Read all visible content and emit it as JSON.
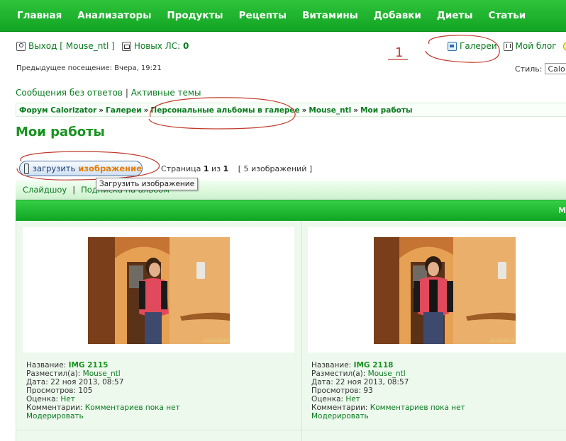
{
  "nav": {
    "items": [
      "Главная",
      "Анализаторы",
      "Продукты",
      "Рецепты",
      "Витамины",
      "Добавки",
      "Диеты",
      "Статьи"
    ]
  },
  "user": {
    "logout_label": "Выход [ Mouse_ntl ]",
    "new_pm_label": "Новых ЛС:",
    "new_pm_count": "0",
    "previous_visit": "Предыдущее посещение: Вчера, 19:21"
  },
  "links": {
    "gallery": "Галереи",
    "blog": "Мой блог"
  },
  "style": {
    "label": "Стиль:",
    "value": "Calo"
  },
  "quick": {
    "unanswered": "Сообщения без ответов",
    "separator": "|",
    "active": "Активные темы"
  },
  "breadcrumb": [
    "Форум Calorizator",
    "Галереи",
    "Персональные альбомы в галерее",
    "Mouse_ntl",
    "Мои работы"
  ],
  "page": {
    "title": "Мои работы"
  },
  "upload": {
    "word1": "загрузить",
    "word2": "изображение",
    "tooltip": "Загрузить изображение"
  },
  "pagination": {
    "prefix": "Страница",
    "current": "1",
    "of": "из",
    "total": "1",
    "count": "[ 5 изображений ]"
  },
  "subbar": {
    "slideshow": "Слайдшоу",
    "separator": "|",
    "subscribe": "Подписка на альбом"
  },
  "greenbar": {
    "label": "M"
  },
  "annotation": {
    "mark": "1"
  },
  "images": [
    {
      "name_label": "Название:",
      "name": "IMG 2115",
      "uploader_label": "Разместил(а):",
      "uploader": "Mouse_ntl",
      "date_label": "Дата:",
      "date": "22 ноя 2013, 08:57",
      "views_label": "Просмотров:",
      "views": "105",
      "rating_label": "Оценка:",
      "rating": "Нет",
      "comments_label": "Комментарии:",
      "comments": "Комментариев пока нет",
      "moderate": "Модерировать",
      "stamp": "22/11/2013"
    },
    {
      "name_label": "Название:",
      "name": "IMG 2118",
      "uploader_label": "Разместил(а):",
      "uploader": "Mouse_ntl",
      "date_label": "Дата:",
      "date": "22 ноя 2013, 08:57",
      "views_label": "Просмотров:",
      "views": "93",
      "rating_label": "Оценка:",
      "rating": "Нет",
      "comments_label": "Комментарии:",
      "comments": "Комментариев пока нет",
      "moderate": "Модерировать",
      "stamp": "22/11/2013"
    }
  ],
  "colors": {
    "nav_green": "#12a424",
    "link_green": "#0a7a1f",
    "title_green": "#17931f",
    "upload_accent": "#e57d06",
    "annotation_red": "#c0392b"
  }
}
